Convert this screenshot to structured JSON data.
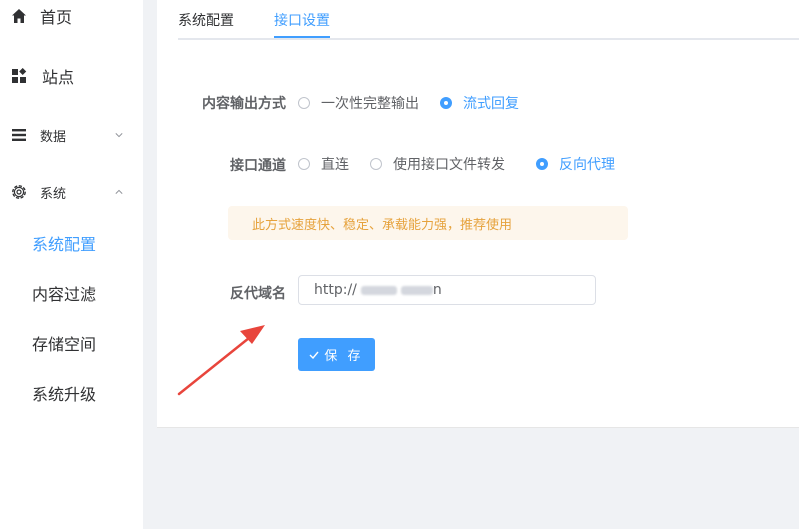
{
  "sidebar": {
    "items": [
      {
        "label": "首页",
        "icon": "home-icon"
      },
      {
        "label": "站点",
        "icon": "apps-icon"
      },
      {
        "label": "数据",
        "icon": "menu-icon"
      },
      {
        "label": "系统",
        "icon": "gear-icon"
      }
    ],
    "sub_items": [
      {
        "label": "系统配置",
        "active": true
      },
      {
        "label": "内容过滤"
      },
      {
        "label": "存储空间"
      },
      {
        "label": "系统升级"
      }
    ]
  },
  "tabs": [
    {
      "label": "系统配置"
    },
    {
      "label": "接口设置",
      "active": true
    }
  ],
  "form": {
    "output_mode": {
      "label": "内容输出方式",
      "options": [
        "一次性完整输出",
        "流式回复"
      ],
      "selected": "流式回复"
    },
    "channel": {
      "label": "接口通道",
      "options": [
        "直连",
        "使用接口文件转发",
        "反向代理"
      ],
      "selected": "反向代理"
    },
    "alert_text": "此方式速度快、稳定、承载能力强，推荐使用",
    "proxy_domain": {
      "label": "反代域名",
      "value_prefix": "http://",
      "value_suffix": "n"
    },
    "save_label": "保 存"
  },
  "colors": {
    "accent": "#409eff",
    "warning_text": "#e6a23c",
    "warning_bg": "#fdf6ec",
    "annotation_arrow": "#e8453c"
  }
}
